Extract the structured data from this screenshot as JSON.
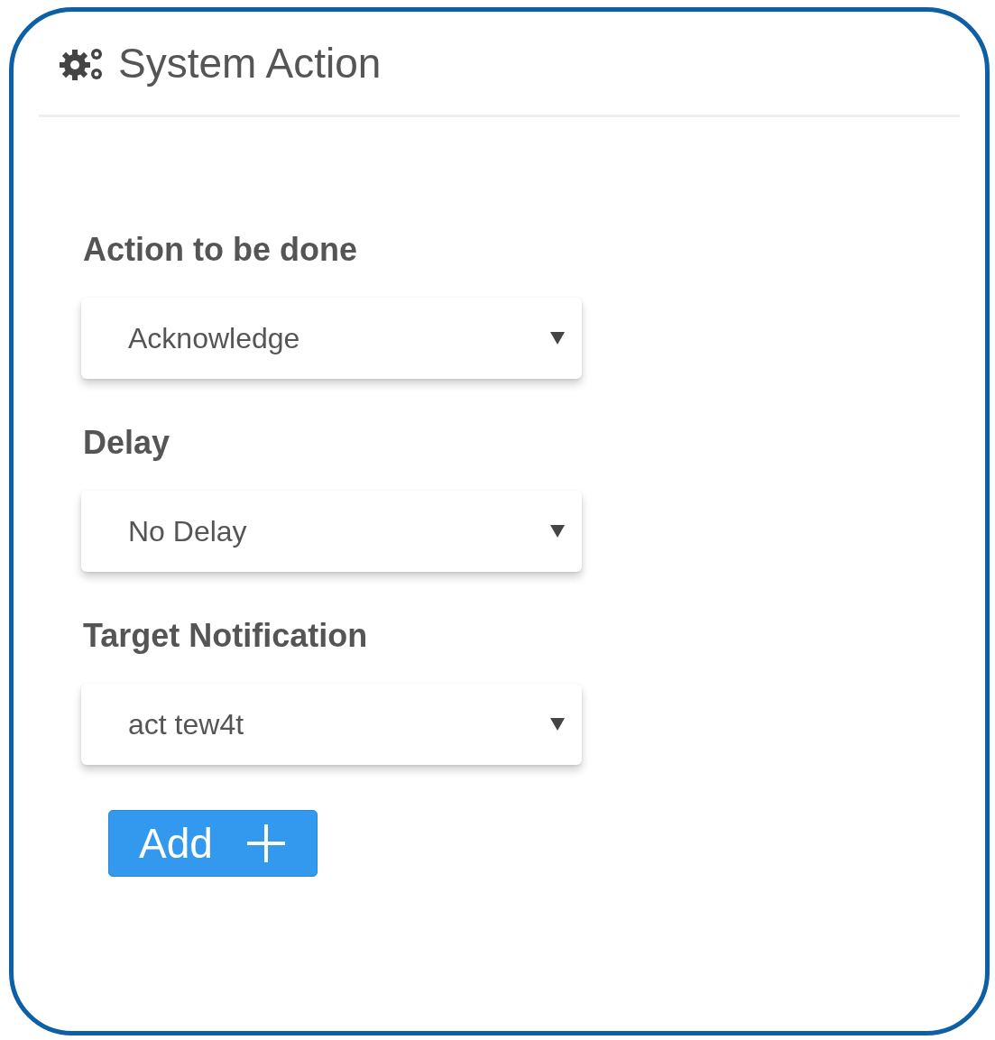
{
  "panel": {
    "title": "System Action"
  },
  "fields": [
    {
      "label": "Action to be done",
      "value": "Acknowledge"
    },
    {
      "label": "Delay",
      "value": "No Delay"
    },
    {
      "label": "Target Notification",
      "value": "act tew4t"
    }
  ],
  "add_button": {
    "label": "Add"
  }
}
